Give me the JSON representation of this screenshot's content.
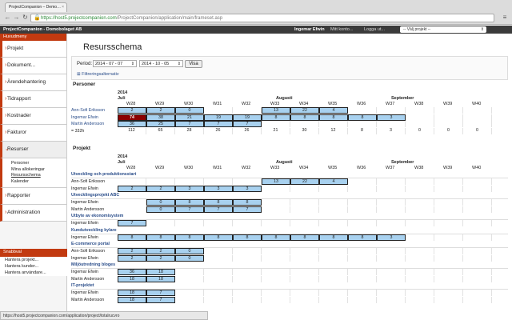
{
  "browser": {
    "tab_title": "ProjectCompanion – Demo…",
    "url_host": "https://host5.projectcompanion.com",
    "url_path": "/ProjectCompanion/application/main/frameset.asp",
    "status_url": "https://host5.projectcompanion.com/application/project/totalrucvro"
  },
  "topbar": {
    "brand": "ProjectCompanion - Domobolaget AB",
    "user": "Ingemar Efwin",
    "account": "Mitt konto...",
    "logout": "Logga ut...",
    "project_select": "-- Välj projekt --"
  },
  "sidebar": {
    "heading": "Huvudmeny",
    "items": [
      {
        "label": "Projekt"
      },
      {
        "label": "Dokument..."
      },
      {
        "label": "Ärendehantering"
      },
      {
        "label": "Tidrapport"
      },
      {
        "label": "Kostnader"
      },
      {
        "label": "Fakturor"
      },
      {
        "label": "Resurser"
      },
      {
        "label": "Rapporter"
      },
      {
        "label": "Administration"
      }
    ],
    "sub": [
      "Personer",
      "Mina allokeringar",
      "Resursschema",
      "Kalender"
    ],
    "quick_heading": "Snabbval",
    "quick": [
      "Hantera projekt...",
      "Hantera kunder...",
      "Hantera användare..."
    ]
  },
  "page": {
    "title": "Resursschema",
    "period_label": "Period:",
    "from": "2014 - 07 - 07",
    "to": "2014 - 10 - 05",
    "show_button": "Visa",
    "filter_toggle": "⊞ Filtreringsalternativ",
    "persons_heading": "Personer",
    "projects_heading": "Projekt"
  },
  "timeline": {
    "year": "2014",
    "months": [
      {
        "label": "Juli",
        "x": 0
      },
      {
        "label": "Augusti",
        "x": 0
      },
      {
        "label": "September",
        "x": 0
      }
    ],
    "weeks": [
      "W28",
      "W29",
      "W30",
      "W31",
      "W32",
      "W33",
      "W34",
      "W35",
      "W36",
      "W37",
      "W38",
      "W39",
      "W40"
    ]
  },
  "persons": [
    {
      "name": "Ann-Sofi Eriksson",
      "cells": [
        "2",
        "2",
        "0",
        "",
        "",
        "13",
        "22",
        "4",
        "",
        "",
        "",
        "",
        ""
      ]
    },
    {
      "name": "Ingemar Efwin",
      "cells": [
        "74",
        "38",
        "21",
        "19",
        "19",
        "8",
        "8",
        "8",
        "8",
        "3",
        "",
        "",
        ""
      ],
      "red": [
        0
      ]
    },
    {
      "name": "Martin Andersson",
      "cells": [
        "36",
        "25",
        "7",
        "7",
        "7",
        "",
        "",
        "",
        "",
        "",
        "",
        "",
        ""
      ]
    },
    {
      "name": "= 332h",
      "cells": [
        "112",
        "65",
        "28",
        "26",
        "26",
        "21",
        "30",
        "12",
        "8",
        "3",
        "0",
        "0",
        "0"
      ],
      "total": true
    }
  ],
  "projects": [
    {
      "title": "Utveckling och produktionsstart",
      "rows": [
        {
          "name": "Ann-Sofi Eriksson",
          "cells": [
            "",
            "",
            "",
            "",
            "",
            "13",
            "22",
            "4",
            "",
            "",
            "",
            "",
            ""
          ]
        },
        {
          "name": "Ingemar Efwin",
          "cells": [
            "2",
            "2",
            "3",
            "3",
            "3",
            "",
            "",
            "",
            "",
            "",
            "",
            "",
            ""
          ]
        }
      ]
    },
    {
      "title": "Utvecklingsprojekt ABC",
      "rows": [
        {
          "name": "Ingemar Efwin",
          "cells": [
            "",
            "0",
            "8",
            "8",
            "8",
            "",
            "",
            "",
            "",
            "",
            "",
            "",
            ""
          ]
        },
        {
          "name": "Martin Andersson",
          "cells": [
            "",
            "0",
            "7",
            "7",
            "7",
            "",
            "",
            "",
            "",
            "",
            "",
            "",
            ""
          ]
        }
      ]
    },
    {
      "title": "Utbyte av ekonomisystem",
      "rows": [
        {
          "name": "Ingemar Efwin",
          "cells": [
            "7",
            "",
            "",
            "",
            "",
            "",
            "",
            "",
            "",
            "",
            "",
            "",
            ""
          ]
        }
      ]
    },
    {
      "title": "Kundutveckling kylare",
      "rows": [
        {
          "name": "Ingemar Efwin",
          "cells": [
            "8",
            "8",
            "8",
            "8",
            "8",
            "8",
            "8",
            "8",
            "8",
            "3",
            "",
            "",
            ""
          ]
        }
      ]
    },
    {
      "title": "E-commerce portal",
      "rows": [
        {
          "name": "Ann-Sofi Eriksson",
          "cells": [
            "2",
            "2",
            "0",
            "",
            "",
            "",
            "",
            "",
            "",
            "",
            "",
            "",
            ""
          ]
        },
        {
          "name": "Ingemar Efwin",
          "cells": [
            "2",
            "2",
            "0",
            "",
            "",
            "",
            "",
            "",
            "",
            "",
            "",
            "",
            ""
          ]
        }
      ]
    },
    {
      "title": "Miljöutredning bloges",
      "rows": [
        {
          "name": "Ingemar Efwin",
          "cells": [
            "36",
            "18",
            "",
            "",
            "",
            "",
            "",
            "",
            "",
            "",
            "",
            "",
            ""
          ]
        },
        {
          "name": "Martin Andersson",
          "cells": [
            "18",
            "18",
            "",
            "",
            "",
            "",
            "",
            "",
            "",
            "",
            "",
            "",
            ""
          ]
        }
      ]
    },
    {
      "title": "IT-projektet",
      "rows": [
        {
          "name": "Ingemar Efwin",
          "cells": [
            "18",
            "7",
            "",
            "",
            "",
            "",
            "",
            "",
            "",
            "",
            "",
            "",
            ""
          ]
        },
        {
          "name": "Martin Andersson",
          "cells": [
            "18",
            "7",
            "",
            "",
            "",
            "",
            "",
            "",
            "",
            "",
            "",
            "",
            ""
          ]
        }
      ]
    }
  ]
}
